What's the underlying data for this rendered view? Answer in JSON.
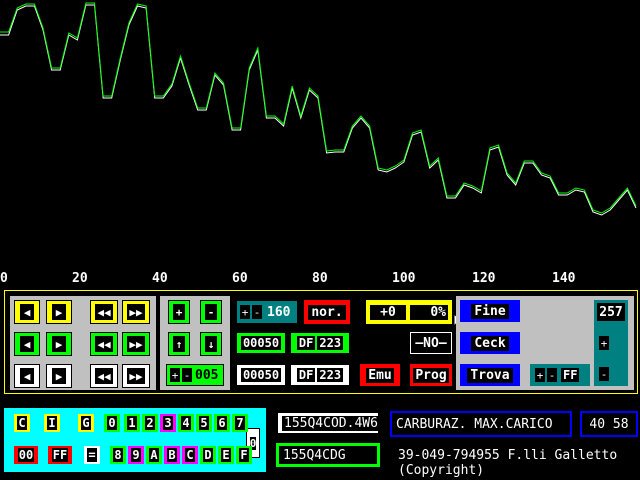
{
  "chart_data": {
    "type": "line",
    "xlim": [
      0,
      158
    ],
    "ylim": [
      0,
      290
    ],
    "x_ticks": [
      "0",
      "20",
      "40",
      "60",
      "80",
      "100",
      "120",
      "140"
    ],
    "series": [
      {
        "color": "#ffffff",
        "values": [
          35,
          35,
          10,
          6,
          6,
          30,
          70,
          70,
          35,
          40,
          5,
          5,
          98,
          98,
          60,
          25,
          6,
          8,
          98,
          98,
          86,
          58,
          85,
          110,
          110,
          75,
          85,
          130,
          130,
          70,
          50,
          118,
          118,
          126,
          88,
          118,
          90,
          98,
          153,
          152,
          152,
          128,
          118,
          128,
          170,
          172,
          168,
          162,
          135,
          132,
          168,
          160,
          198,
          198,
          185,
          188,
          193,
          150,
          147,
          175,
          185,
          163,
          163,
          175,
          178,
          195,
          195,
          190,
          192,
          212,
          215,
          210,
          200,
          190,
          208
        ]
      },
      {
        "color": "#00ff00",
        "values": [
          32,
          32,
          8,
          4,
          4,
          28,
          68,
          68,
          33,
          38,
          3,
          3,
          96,
          96,
          58,
          23,
          4,
          6,
          96,
          96,
          84,
          56,
          83,
          108,
          108,
          73,
          83,
          128,
          128,
          68,
          48,
          116,
          116,
          124,
          86,
          116,
          88,
          96,
          151,
          150,
          150,
          126,
          116,
          126,
          168,
          170,
          166,
          160,
          133,
          130,
          166,
          158,
          196,
          196,
          183,
          186,
          191,
          148,
          145,
          173,
          183,
          161,
          161,
          173,
          176,
          193,
          193,
          188,
          190,
          210,
          213,
          208,
          198,
          188,
          206
        ]
      }
    ]
  },
  "colors": {
    "yellow": "#ffff00",
    "green": "#00ff00",
    "white": "#ffffff",
    "blue": "#0000ff",
    "red": "#ff0000",
    "teal": "#008080",
    "cyan": "#00ffff",
    "magenta": "#ff00ff",
    "gray": "#c0c0c0"
  },
  "controls": {
    "plus": "+",
    "minus": "-",
    "value_160": "160",
    "nor": "nor.",
    "offset_plus": "+0",
    "offset_pct": "0%",
    "no": "—NO—",
    "addr1": "00050",
    "df1_prefix": "DF",
    "df1_val": "223",
    "addr2": "00050",
    "df2_prefix": "DF",
    "df2_val": "223",
    "emu": "Emu",
    "prog": "Prog",
    "step": "005",
    "fine": "Fine",
    "ceck": "Ceck",
    "trova": "Trova",
    "ff": "FF",
    "value_257": "257"
  },
  "hexpad": {
    "row1": [
      "C",
      "I",
      "G",
      "0",
      "1",
      "2",
      "3",
      "4",
      "5",
      "6",
      "7"
    ],
    "row2": [
      "00",
      "FF",
      "=",
      "8",
      "9",
      "A",
      "B",
      "C",
      "D",
      "E",
      "F"
    ],
    "zero": "0"
  },
  "info": {
    "cod": "155Q4COD.4W6",
    "cdg": "155Q4CDG",
    "title": "CARBURAZ. MAX.CARICO",
    "nums": "40 58",
    "phone": "39-049-794955 F.lli Galletto",
    "copyright": "(Copyright)"
  }
}
